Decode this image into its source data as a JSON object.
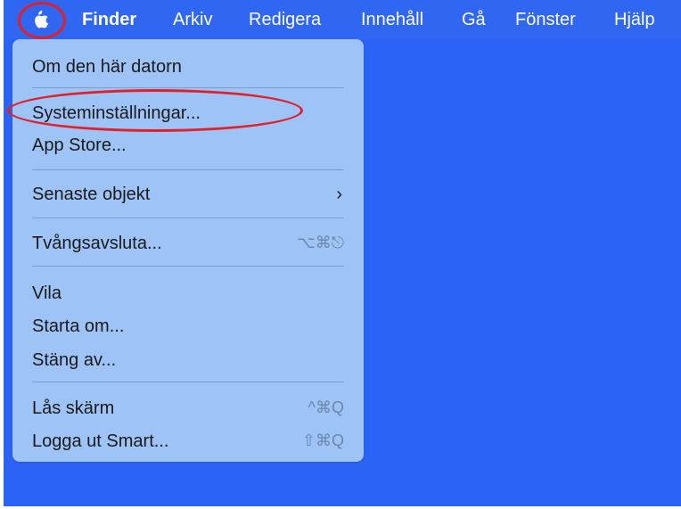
{
  "menubar": {
    "apple_icon": "apple-logo-icon",
    "items": [
      "Finder",
      "Arkiv",
      "Redigera",
      "Innehåll",
      "Gå",
      "Fönster",
      "Hjälp"
    ]
  },
  "dropdown": {
    "about": "Om den här datorn",
    "system_settings": "Systeminställningar...",
    "app_store": "App Store...",
    "recent_items": "Senaste objekt",
    "recent_chevron": "chevron-right-icon",
    "force_quit": "Tvångsavsluta...",
    "force_quit_shortcut": "⌥⌘⎋",
    "sleep": "Vila",
    "restart": "Starta om...",
    "shutdown": "Stäng av...",
    "lock_screen": "Lås skärm",
    "lock_screen_shortcut": "^⌘Q",
    "log_out": "Logga ut Smart...",
    "log_out_shortcut": "⇧⌘Q"
  },
  "colors": {
    "desktop": "#2b63f5",
    "menu_background": "#9ec3f6",
    "annotation_red": "#e0202a"
  }
}
